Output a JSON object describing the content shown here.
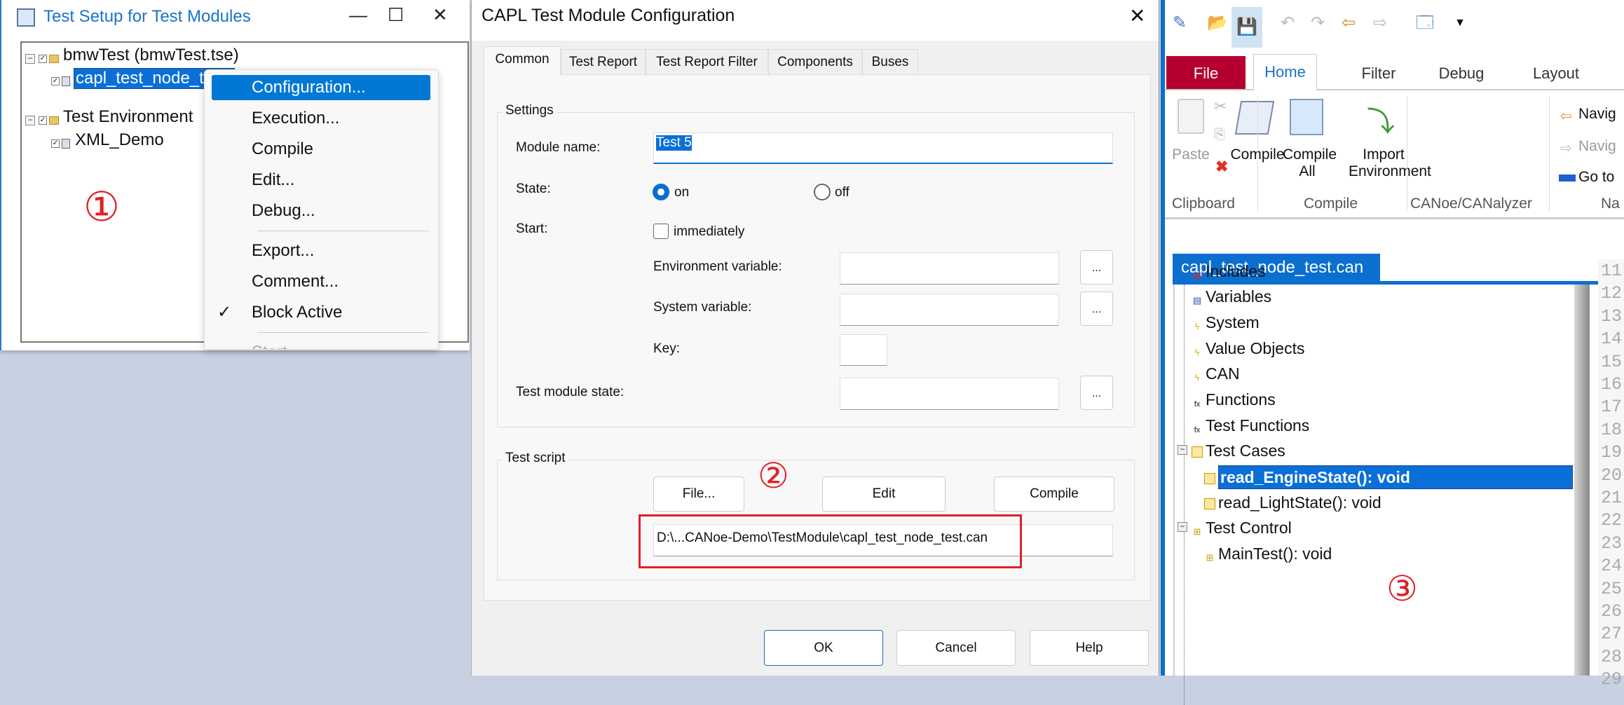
{
  "test_setup": {
    "title": "Test Setup for Test Modules",
    "window_buttons": {
      "minimize": "—",
      "maximize": "☐",
      "close": "✕"
    },
    "tree": [
      {
        "label": "bmwTest  (bmwTest.tse)",
        "children": [
          {
            "label": "capl_test_node_t",
            "selected": true
          }
        ]
      },
      {
        "label": "Test Environment",
        "children": [
          {
            "label": "XML_Demo"
          }
        ]
      }
    ],
    "annotation": "①"
  },
  "context_menu": {
    "items": [
      {
        "label": "Configuration...",
        "highlighted": true
      },
      {
        "label": "Execution..."
      },
      {
        "label": "Compile"
      },
      {
        "label": "Edit..."
      },
      {
        "label": "Debug..."
      },
      {
        "label": "Export..."
      },
      {
        "label": "Comment..."
      },
      {
        "label": "Block Active",
        "checked": true,
        "check_mark": "✓"
      },
      {
        "label": "Start",
        "disabled": true
      }
    ]
  },
  "dialog": {
    "title": "CAPL Test Module Configuration",
    "close": "✕",
    "tabs": [
      "Common",
      "Test Report",
      "Test Report Filter",
      "Components",
      "Buses"
    ],
    "active_tab": "Common",
    "settings": {
      "group_label": "Settings",
      "module_name_label": "Module name:",
      "module_name_value": "Test 5",
      "state_label": "State:",
      "state_on": "on",
      "state_off": "off",
      "state_selected": "on",
      "start_label": "Start:",
      "immediately_label": "immediately",
      "immediately_checked": false,
      "env_var_label": "Environment variable:",
      "env_var_value": "",
      "sys_var_label": "System variable:",
      "sys_var_value": "",
      "key_label": "Key:",
      "key_value": "",
      "test_module_state_label": "Test module state:",
      "test_module_state_value": "",
      "browse": "..."
    },
    "test_script": {
      "group_label": "Test script",
      "file_button": "File...",
      "edit_button": "Edit",
      "compile_button": "Compile",
      "path": "D:\\...CANoe-Demo\\TestModule\\capl_test_node_test.can",
      "annotation": "②"
    },
    "buttons": {
      "ok": "OK",
      "cancel": "Cancel",
      "help": "Help"
    }
  },
  "editor_app": {
    "ribbon_tabs": [
      "File",
      "Home",
      "Filter",
      "Debug",
      "Layout"
    ],
    "active_ribbon_tab": "Home",
    "file_tab_color": "#b5002f",
    "accent_color": "#0a6fcf",
    "ribbon": {
      "paste": "Paste",
      "compile": "Compile",
      "compile_all": "Compile All",
      "import_environment": "Import Environment",
      "navigate_back": "Navig",
      "navigate_forward": "Navig",
      "go_to": "Go to",
      "groups": [
        "Clipboard",
        "Compile",
        "CANoe/CANalyzer",
        "Na"
      ]
    },
    "editor_tab": {
      "label": "capl_test_node_test.can",
      "close": "✕"
    },
    "tree": [
      {
        "label": "Includes",
        "level": 0
      },
      {
        "label": "Variables",
        "level": 0
      },
      {
        "label": "System",
        "level": 0
      },
      {
        "label": "Value Objects",
        "level": 0
      },
      {
        "label": "CAN",
        "level": 0
      },
      {
        "label": "Functions",
        "level": 0
      },
      {
        "label": "Test Functions",
        "level": 0
      },
      {
        "label": "Test Cases",
        "level": 0,
        "expanded": true
      },
      {
        "label": "read_EngineState(): void",
        "level": 1,
        "selected": true
      },
      {
        "label": "read_LightState(): void",
        "level": 1
      },
      {
        "label": "Test Control",
        "level": 0,
        "expanded": true
      },
      {
        "label": "MainTest(): void",
        "level": 1
      }
    ],
    "line_numbers": [
      "11",
      "12",
      "13",
      "14",
      "15",
      "16",
      "17",
      "18",
      "19",
      "20",
      "21",
      "22",
      "23",
      "24",
      "25",
      "26",
      "27",
      "28",
      "29"
    ],
    "annotation": "③"
  }
}
